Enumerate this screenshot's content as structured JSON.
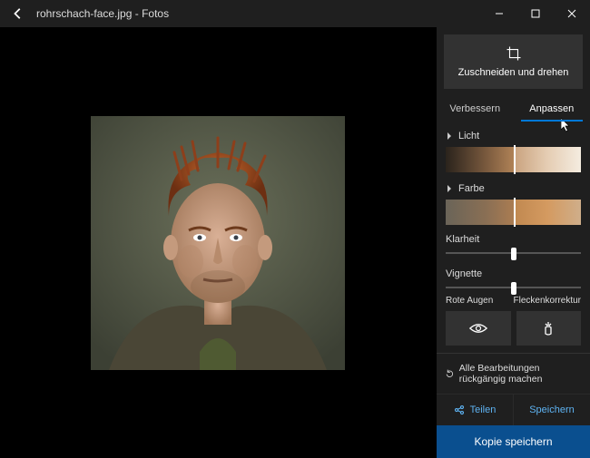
{
  "titlebar": {
    "filename": "rohrschach-face.jpg",
    "app": "Fotos",
    "separator": " - "
  },
  "sidebar": {
    "crop_rotate": "Zuschneiden und drehen",
    "tabs": {
      "enhance": "Verbessern",
      "adjust": "Anpassen"
    },
    "light": "Licht",
    "color": "Farbe",
    "clarity": "Klarheit",
    "vignette": "Vignette",
    "red_eye": "Rote Augen",
    "spot_fix": "Fleckenkorrektur",
    "undo_all": "Alle Bearbeitungen rückgängig machen",
    "share": "Teilen",
    "save": "Speichern",
    "save_copy": "Kopie speichern",
    "slider_values": {
      "clarity": 50,
      "vignette": 50
    }
  },
  "colors": {
    "accent": "#0078d7",
    "button_bg": "#323232",
    "sidebar_bg": "#1f1f1f"
  }
}
